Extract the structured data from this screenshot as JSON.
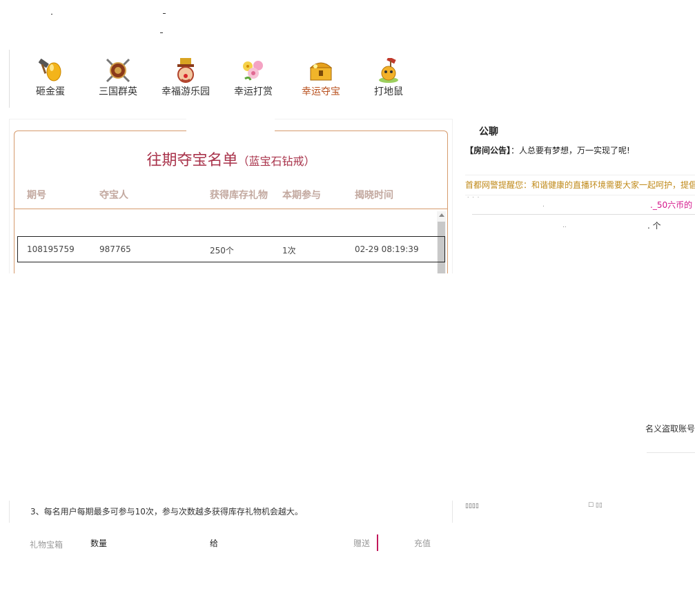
{
  "games": [
    {
      "label": "砸金蛋",
      "icon": "golden-egg-hammer-icon"
    },
    {
      "label": "三国群英",
      "icon": "crossed-swords-shield-icon"
    },
    {
      "label": "幸福游乐园",
      "icon": "clown-icon"
    },
    {
      "label": "幸运打赏",
      "icon": "flower-bouquet-icon"
    },
    {
      "label": "幸运夺宝",
      "icon": "treasure-chest-icon",
      "active": true
    },
    {
      "label": "打地鼠",
      "icon": "mole-hammer-icon"
    }
  ],
  "history": {
    "title": "往期夺宝名单",
    "subtitle": "（蓝宝石钻戒）",
    "columns": [
      "期号",
      "夺宝人",
      "获得库存礼物",
      "本期参与",
      "揭晓时间"
    ],
    "rows": [
      {
        "issue": "108195759",
        "winner": "987765",
        "gift": "250个",
        "times": "1次",
        "time": "02-29 08:19:39"
      }
    ]
  },
  "chat": {
    "title": "公聊",
    "notice_label": "【房间公告】",
    "notice_text": "：人总要有梦想，万一实现了呢!",
    "police_text": "首都网警提醒您：和谐健康的直播环境需要大家一起呵护，提倡",
    "pink_fragment": "._50六币的",
    "ge_fragment": ". 个",
    "steal_fragment": "名义盗取账号"
  },
  "rules": {
    "rule3": "3、每名用户每期最多可参与10次，参与次数越多获得库存礼物机会越大。"
  },
  "bottom": {
    "gift_box": "礼物宝箱",
    "quantity": "数量",
    "to": "给",
    "send": "赠送",
    "recharge": "充值"
  },
  "colors": {
    "accent_orange": "#b8501e",
    "panel_border": "#d59a6c",
    "title_red": "#a8324a",
    "police_gold": "#c08a1a",
    "pink": "#d4148a"
  }
}
